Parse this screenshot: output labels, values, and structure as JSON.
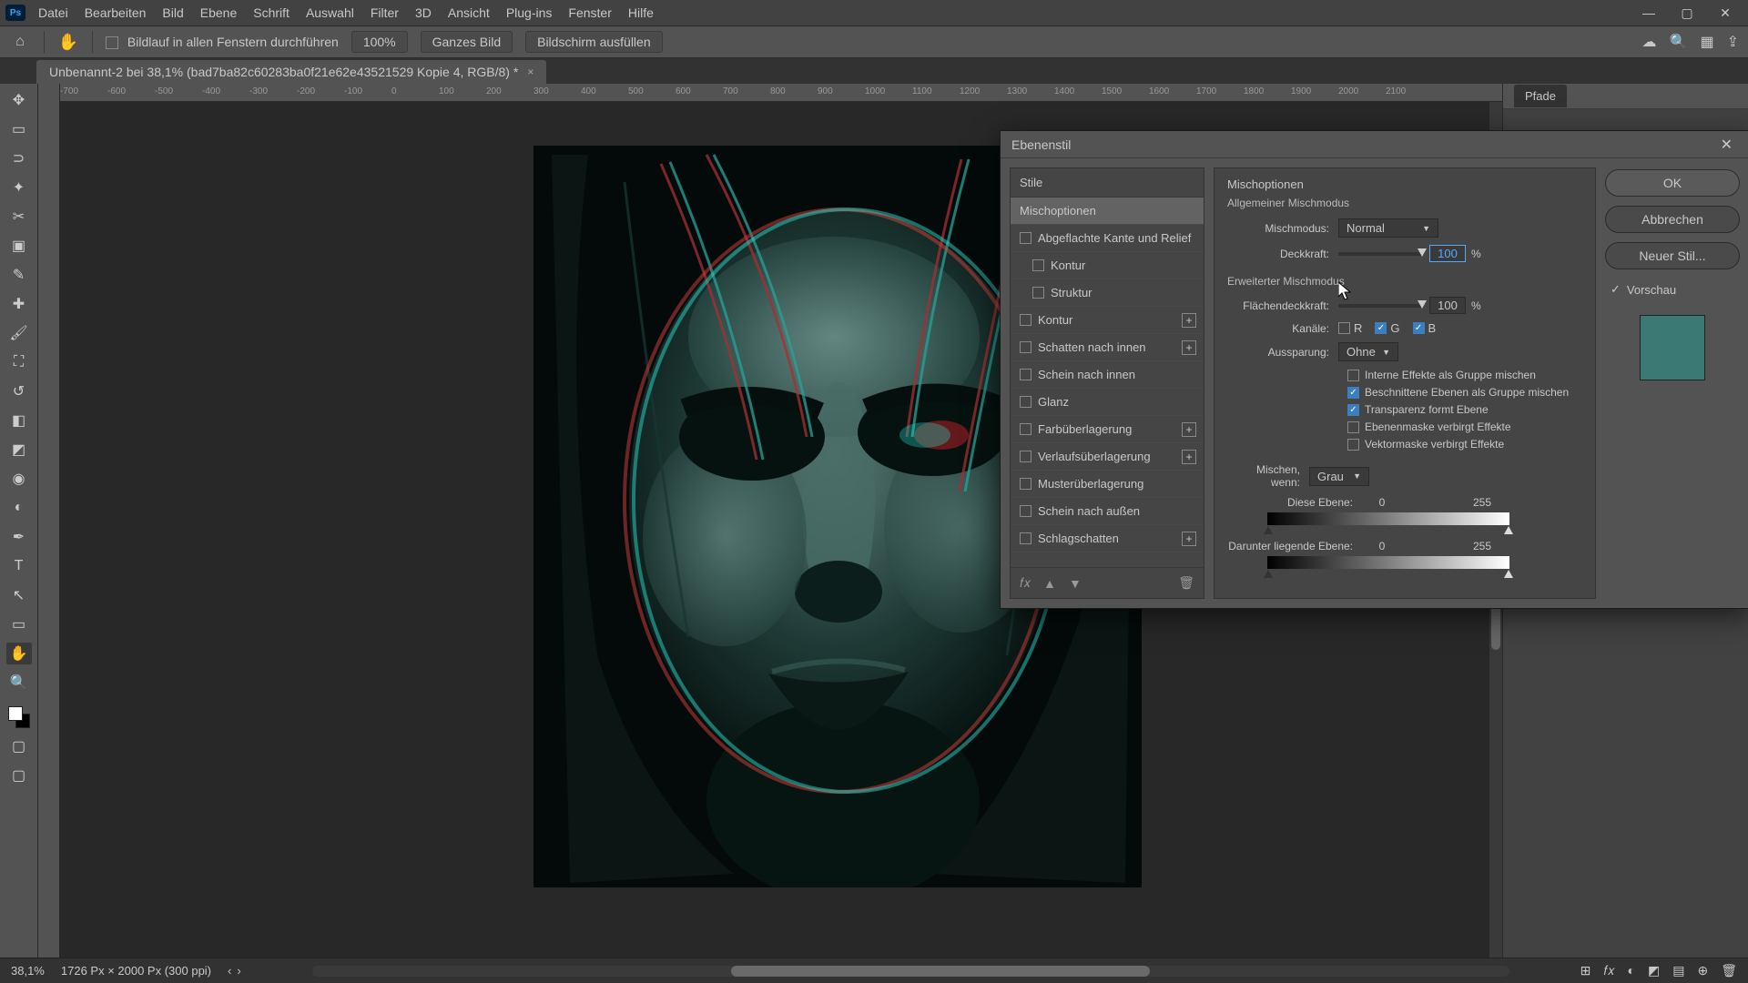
{
  "titlebar": {
    "ps": "Ps",
    "menus": [
      "Datei",
      "Bearbeiten",
      "Bild",
      "Ebene",
      "Schrift",
      "Auswahl",
      "Filter",
      "3D",
      "Ansicht",
      "Plug-ins",
      "Fenster",
      "Hilfe"
    ],
    "win_min": "—",
    "win_max": "▢",
    "win_close": "✕"
  },
  "optionsbar": {
    "home_glyph": "⌂",
    "hand_glyph": "✋",
    "scroll_all_label": "Bildlauf in allen Fenstern durchführen",
    "zoom_pill": "100%",
    "fit_pill": "Ganzes Bild",
    "fill_pill": "Bildschirm ausfüllen",
    "cloud_glyph": "☁",
    "search_glyph": "🔍",
    "workspace_glyph": "▦",
    "share_glyph": "⇪"
  },
  "tab": {
    "title": "Unbenannt-2 bei 38,1% (bad7ba82c60283ba0f21e62e43521529 Kopie 4, RGB/8) *",
    "close": "×"
  },
  "tools": [
    {
      "name": "move",
      "glyph": "✥"
    },
    {
      "name": "marquee",
      "glyph": "▭"
    },
    {
      "name": "lasso",
      "glyph": "⊃"
    },
    {
      "name": "wand",
      "glyph": "✦"
    },
    {
      "name": "crop",
      "glyph": "✂"
    },
    {
      "name": "frame",
      "glyph": "▣"
    },
    {
      "name": "eyedropper",
      "glyph": "✎"
    },
    {
      "name": "healing",
      "glyph": "✚"
    },
    {
      "name": "brush",
      "glyph": "🖌"
    },
    {
      "name": "stamp",
      "glyph": "⛶"
    },
    {
      "name": "history",
      "glyph": "↺"
    },
    {
      "name": "eraser",
      "glyph": "◧"
    },
    {
      "name": "gradient",
      "glyph": "◩"
    },
    {
      "name": "blur",
      "glyph": "◉"
    },
    {
      "name": "dodge",
      "glyph": "◐"
    },
    {
      "name": "pen",
      "glyph": "✒"
    },
    {
      "name": "type",
      "glyph": "T"
    },
    {
      "name": "path",
      "glyph": "↖"
    },
    {
      "name": "shape",
      "glyph": "▭"
    },
    {
      "name": "hand",
      "glyph": "✋",
      "active": true
    },
    {
      "name": "zoom",
      "glyph": "🔍"
    }
  ],
  "ruler_ticks": [
    "-700",
    "-600",
    "-500",
    "-400",
    "-300",
    "-200",
    "-100",
    "0",
    "100",
    "200",
    "300",
    "400",
    "500",
    "600",
    "700",
    "800",
    "900",
    "1000",
    "1100",
    "1200",
    "1300",
    "1400",
    "1500",
    "1600",
    "1700",
    "1800",
    "1900",
    "2000",
    "2100"
  ],
  "rightpanel": {
    "tab": "Pfade"
  },
  "statusbar": {
    "zoom": "38,1%",
    "docinfo": "1726 Px × 2000 Px (300 ppi)",
    "arrow_l": "‹",
    "arrow_r": "›"
  },
  "status_icons": [
    "⊞",
    "𝑓𝑥",
    "◐",
    "◩",
    "▤",
    "⊕",
    "🗑"
  ],
  "dialog": {
    "title": "Ebenenstil",
    "close": "✕",
    "styles_header": "Stile",
    "styles": [
      {
        "key": "mischoptionen",
        "label": "Mischoptionen",
        "selected": true,
        "indent": 0,
        "checkbox": false
      },
      {
        "key": "bevel",
        "label": "Abgeflachte Kante und Relief",
        "indent": 0,
        "checkbox": true
      },
      {
        "key": "kontur1",
        "label": "Kontur",
        "indent": 1,
        "checkbox": true
      },
      {
        "key": "struktur",
        "label": "Struktur",
        "indent": 1,
        "checkbox": true
      },
      {
        "key": "kontur2",
        "label": "Kontur",
        "indent": 0,
        "checkbox": true,
        "plus": true
      },
      {
        "key": "innershadow",
        "label": "Schatten nach innen",
        "indent": 0,
        "checkbox": true,
        "plus": true
      },
      {
        "key": "innerglow",
        "label": "Schein nach innen",
        "indent": 0,
        "checkbox": true
      },
      {
        "key": "glanz",
        "label": "Glanz",
        "indent": 0,
        "checkbox": true
      },
      {
        "key": "coloroverlay",
        "label": "Farbüberlagerung",
        "indent": 0,
        "checkbox": true,
        "plus": true
      },
      {
        "key": "gradoverlay",
        "label": "Verlaufsüberlagerung",
        "indent": 0,
        "checkbox": true,
        "plus": true
      },
      {
        "key": "patternoverlay",
        "label": "Musterüberlagerung",
        "indent": 0,
        "checkbox": true
      },
      {
        "key": "outerglow",
        "label": "Schein nach außen",
        "indent": 0,
        "checkbox": true
      },
      {
        "key": "dropshadow",
        "label": "Schlagschatten",
        "indent": 0,
        "checkbox": true,
        "plus": true
      }
    ],
    "footer_icons": {
      "fx": "𝑓𝑥",
      "up": "▲",
      "down": "▼",
      "trash": "🗑"
    },
    "opts": {
      "section": "Mischoptionen",
      "sub": "Allgemeiner Mischmodus",
      "mode_label": "Mischmodus:",
      "mode_value": "Normal",
      "opacity_label": "Deckkraft:",
      "opacity_value": "100",
      "unit_pct": "%",
      "adv_header": "Erweiterter Mischmodus",
      "fill_label": "Flächendeckkraft:",
      "fill_value": "100",
      "channels_label": "Kanäle:",
      "ch_r": "R",
      "ch_g": "G",
      "ch_b": "B",
      "check": "✓",
      "knockout_label": "Aussparung:",
      "knockout_value": "Ohne",
      "opt1": "Interne Effekte als Gruppe mischen",
      "opt2": "Beschnittene Ebenen als Gruppe mischen",
      "opt3": "Transparenz formt Ebene",
      "opt4": "Ebenenmaske verbirgt Effekte",
      "opt5": "Vektormaske verbirgt Effekte",
      "blendif_label": "Mischen, wenn:",
      "blendif_value": "Grau",
      "this_label": "Diese Ebene:",
      "this_low": "0",
      "this_high": "255",
      "under_label": "Darunter liegende Ebene:",
      "under_low": "0",
      "under_high": "255"
    },
    "buttons": {
      "ok": "OK",
      "cancel": "Abbrechen",
      "newstyle": "Neuer Stil...",
      "preview": "Vorschau"
    },
    "preview_color": "#3b7a74"
  }
}
